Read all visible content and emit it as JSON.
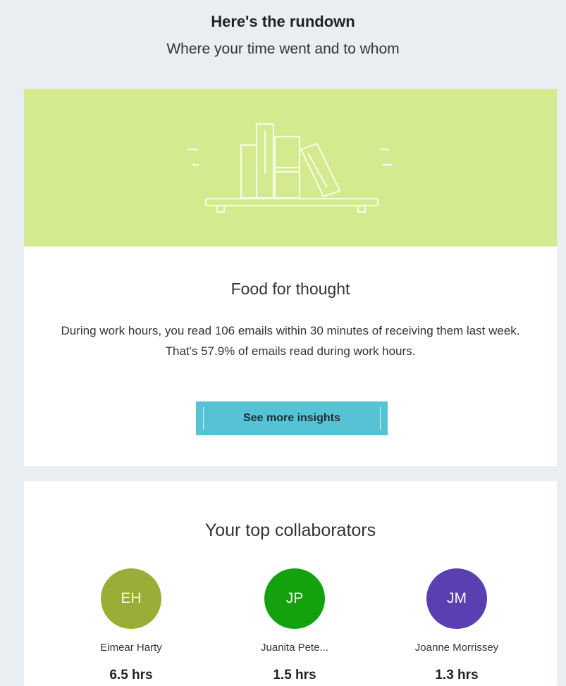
{
  "header": {
    "title": "Here's the rundown",
    "subtitle": "Where your time went and to whom"
  },
  "insight_card": {
    "illustration": "bookshelf-illustration",
    "banner_color": "#d3ea8e",
    "title": "Food for thought",
    "body": "During work hours, you read 106 emails within 30 minutes of receiving them last week. That's 57.9% of emails read during work hours.",
    "button_label": "See more insights",
    "button_color": "#56c3d5"
  },
  "collaborators": {
    "title": "Your top collaborators",
    "items": [
      {
        "initials": "EH",
        "name": "Eimear Harty",
        "hours": "6.5 hrs",
        "color": "#9aad36"
      },
      {
        "initials": "JP",
        "name": "Juanita Pete...",
        "hours": "1.5 hrs",
        "color": "#13a10e"
      },
      {
        "initials": "JM",
        "name": "Joanne Morrissey",
        "hours": "1.3 hrs",
        "color": "#5a3fb3"
      }
    ]
  }
}
